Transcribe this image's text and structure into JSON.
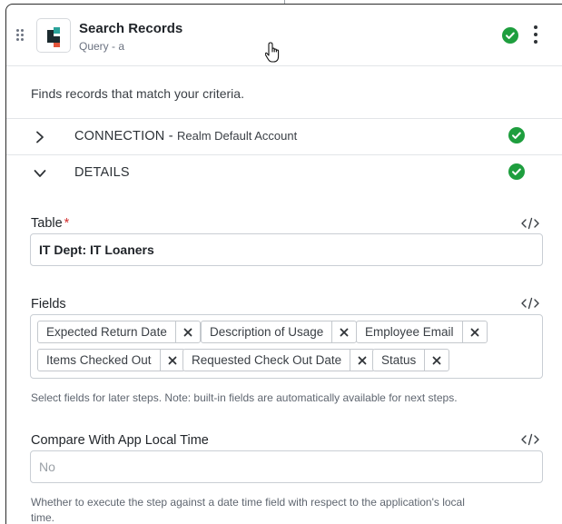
{
  "step": {
    "title": "Search Records",
    "subtitle": "Query - a",
    "description": "Finds records that match your criteria.",
    "status": "complete"
  },
  "sections": {
    "connection": {
      "label": "CONNECTION",
      "separator": " - ",
      "value": "Realm Default Account",
      "expanded": false,
      "status": "complete"
    },
    "details": {
      "label": "DETAILS",
      "expanded": true,
      "status": "complete"
    }
  },
  "table": {
    "label": "Table",
    "required_mark": "*",
    "value": "IT Dept: IT Loaners"
  },
  "fields": {
    "label": "Fields",
    "chips": [
      "Expected Return Date",
      "Description of Usage",
      "Employee Email",
      "Items Checked Out",
      "Requested Check Out Date",
      "Status"
    ],
    "help": "Select fields for later steps. Note: built-in fields are automatically available for next steps."
  },
  "compare_local_time": {
    "label": "Compare With App Local Time",
    "placeholder": "No",
    "help_line1": "Whether to execute the step against a date time field with respect to the application's local",
    "help_line2": "time."
  },
  "icons": {
    "drag": "drag-handle-icon",
    "logo": "app-logo-icon",
    "status": "check-circle-icon",
    "menu": "kebab-menu-icon",
    "expand": "chevron-right-icon",
    "collapse": "chevron-down-icon",
    "code": "code-toggle-icon",
    "remove": "close-icon",
    "cursor": "hand-pointer-cursor-icon"
  },
  "colors": {
    "success": "#1e9e3e",
    "required": "#d32f2f",
    "border": "#c9ced4",
    "logo_dark": "#1b2a2f",
    "logo_teal": "#2aa39a",
    "logo_red": "#e2543b"
  }
}
